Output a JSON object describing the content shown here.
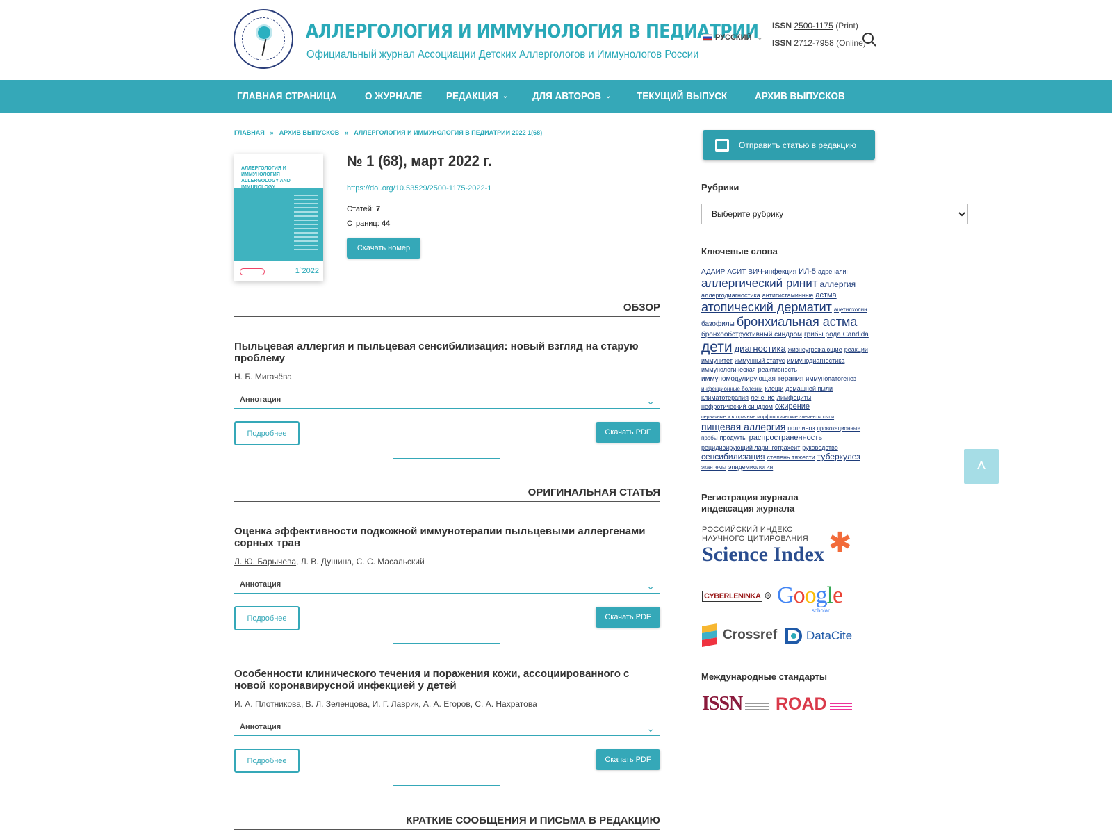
{
  "header": {
    "title": "АЛЛЕРГОЛОГИЯ И ИММУНОЛОГИЯ В ПЕДИАТРИИ",
    "subtitle": "Официальный журнал Ассоциации Детских Аллергологов и Иммунологов России",
    "language": "РУССКИЙ",
    "issn_print": {
      "label": "ISSN",
      "value": "2500-1175",
      "suffix": "(Print)"
    },
    "issn_online": {
      "label": "ISSN",
      "value": "2712-7958",
      "suffix": "(Online)"
    }
  },
  "nav": [
    {
      "label": "ГЛАВНАЯ СТРАНИЦА",
      "dropdown": false
    },
    {
      "label": "О ЖУРНАЛЕ",
      "dropdown": false
    },
    {
      "label": "РЕДАКЦИЯ",
      "dropdown": true
    },
    {
      "label": "ДЛЯ АВТОРОВ",
      "dropdown": true
    },
    {
      "label": "ТЕКУЩИЙ ВЫПУСК",
      "dropdown": false
    },
    {
      "label": "АРХИВ ВЫПУСКОВ",
      "dropdown": false
    }
  ],
  "breadcrumb": [
    "ГЛАВНАЯ",
    "АРХИВ ВЫПУСКОВ",
    "АЛЛЕРГОЛОГИЯ И ИММУНОЛОГИЯ В ПЕДИАТРИИ 2022 1(68)"
  ],
  "breadcrumb_sep": "»",
  "cover": {
    "title": "АЛЛЕРГОЛОГИЯ И ИММУНОЛОГИЯ ALLERGOLOGY AND IMMUNOLOGY",
    "year": "1`2022"
  },
  "issue": {
    "title": "№ 1 (68), март 2022 г.",
    "doi": "https://doi.org/10.53529/2500-1175-2022-1",
    "articles_label": "Статей:",
    "articles_count": "7",
    "pages_label": "Страниц:",
    "pages_count": "44",
    "download_label": "Скачать номер"
  },
  "sections": [
    {
      "heading": "ОБЗОР",
      "articles": [
        {
          "title": "Пыльцевая аллергия и пыльцевая сенсибилизация: новый взгляд на старую проблему",
          "authors_linked": "",
          "authors_rest": "Н. Б. Мигачёва"
        }
      ]
    },
    {
      "heading": "ОРИГИНАЛЬНАЯ СТАТЬЯ",
      "articles": [
        {
          "title": "Оценка эффективности подкожной иммунотерапии пыльцевыми аллергенами сорных трав",
          "authors_linked": "Л. Ю. Барычева",
          "authors_rest": ", Л. В. Душина, С. С. Масальский"
        },
        {
          "title": "Особенности клинического течения и поражения кожи, ассоциированного с новой коронавирусной инфекцией у детей",
          "authors_linked": "И. А. Плотникова",
          "authors_rest": ", В. Л. Зеленцова, И. Г. Лаврик, А. А. Егоров, С. А. Нахратова"
        }
      ]
    },
    {
      "heading": "КРАТКИЕ СООБЩЕНИЯ И ПИСЬМА В РЕДАКЦИЮ",
      "articles": []
    }
  ],
  "article_buttons": {
    "annotation": "Аннотация",
    "more": "Подробнее",
    "pdf": "Скачать PDF"
  },
  "sidebar": {
    "submit_label": "Отправить статью в редакцию",
    "rubrics_heading": "Рубрики",
    "rubrics_selected": "Выберите рубрику",
    "keywords_heading": "Ключевые слова",
    "keywords": [
      {
        "text": "АДАИР",
        "size": 10
      },
      {
        "text": "АСИТ",
        "size": 10
      },
      {
        "text": "ВИЧ-инфекция",
        "size": 10
      },
      {
        "text": "ИЛ-5",
        "size": 11
      },
      {
        "text": "адреналин",
        "size": 9
      },
      {
        "text": "аллергический ринит",
        "size": 17
      },
      {
        "text": "аллергия",
        "size": 12
      },
      {
        "text": "аллергодиагностика",
        "size": 9
      },
      {
        "text": "антигистаминные",
        "size": 9
      },
      {
        "text": "астма",
        "size": 11
      },
      {
        "text": "атопический дерматит",
        "size": 18
      },
      {
        "text": "ацетилхолин",
        "size": 8
      },
      {
        "text": "базофилы",
        "size": 10
      },
      {
        "text": "бронхиальная астма",
        "size": 18
      },
      {
        "text": "бронхообструктивный синдром",
        "size": 10
      },
      {
        "text": "грибы рода Candida",
        "size": 10
      },
      {
        "text": "дети",
        "size": 21
      },
      {
        "text": "диагностика",
        "size": 13
      },
      {
        "text": "жизнеугрожающие",
        "size": 9
      },
      {
        "text": "реакции",
        "size": 9
      },
      {
        "text": "иммунитет",
        "size": 9
      },
      {
        "text": "иммунный статус",
        "size": 9
      },
      {
        "text": "иммунодиагностика",
        "size": 9
      },
      {
        "text": "иммунологическая",
        "size": 9
      },
      {
        "text": "реактивность",
        "size": 9
      },
      {
        "text": "иммуномодулирующая терапия",
        "size": 10
      },
      {
        "text": "иммунопатогенез",
        "size": 9
      },
      {
        "text": "инфекционные болезни",
        "size": 8
      },
      {
        "text": "клещи",
        "size": 9
      },
      {
        "text": "домашней пыли",
        "size": 9
      },
      {
        "text": "климатотерапия",
        "size": 9
      },
      {
        "text": "лечение",
        "size": 9
      },
      {
        "text": "лимфоциты",
        "size": 9
      },
      {
        "text": "нефротический синдром",
        "size": 9
      },
      {
        "text": "ожирение",
        "size": 11
      },
      {
        "text": "первичные и вторичные морфологические элементы сыпи",
        "size": 7
      },
      {
        "text": "пищевая аллергия",
        "size": 14
      },
      {
        "text": "поллиноз",
        "size": 9
      },
      {
        "text": "провокационные",
        "size": 8
      },
      {
        "text": "пробы",
        "size": 8
      },
      {
        "text": "продукты",
        "size": 9
      },
      {
        "text": "распространенность",
        "size": 11
      },
      {
        "text": "рецидивирующий ларинготрахеит",
        "size": 9
      },
      {
        "text": "руководство",
        "size": 9
      },
      {
        "text": "сенсибилизация",
        "size": 12
      },
      {
        "text": "степень тяжести",
        "size": 9
      },
      {
        "text": "туберкулез",
        "size": 12
      },
      {
        "text": "экантемы",
        "size": 8
      },
      {
        "text": "эпидемиология",
        "size": 9
      }
    ],
    "registration_heading_1": "Регистрация журнала",
    "registration_heading_2": "индексация журнала",
    "science_index_small_1": "РОССИЙСКИЙ ИНДЕКС",
    "science_index_small_2": "НАУЧНОГО ЦИТИРОВАНИЯ",
    "science_index_big": "Science Index",
    "cyberleninka": "CYBERLENINKA",
    "google_scholar_sub": "scholar",
    "crossref": "Crossref",
    "datacite": "DataCite",
    "intl_heading": "Международные стандарты",
    "issn_logo": "ISSN",
    "road_logo": "ROAD"
  },
  "colors": {
    "accent": "#35a8b8",
    "title": "#2aa9b8",
    "link": "#1e3c7a"
  }
}
